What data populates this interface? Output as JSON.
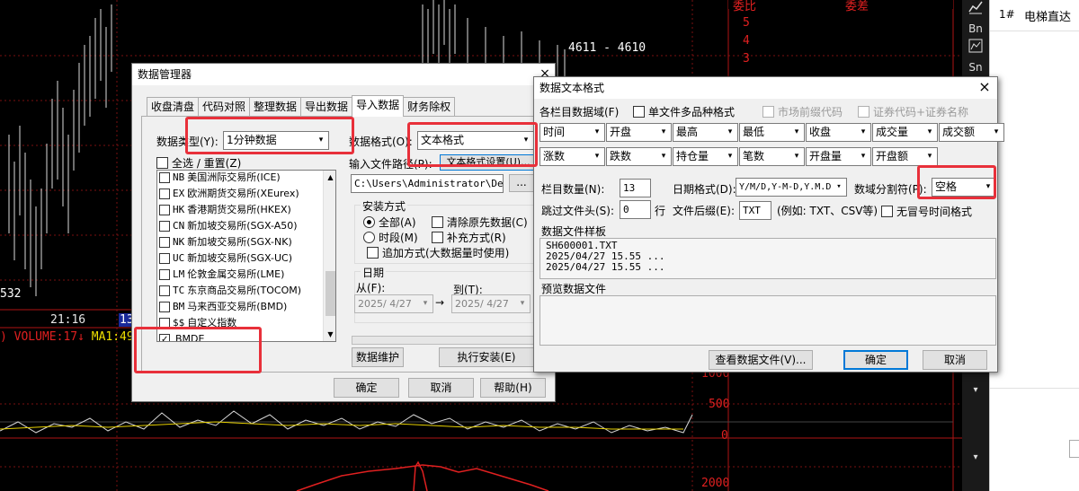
{
  "chart": {
    "price_label": "4611 - 4610",
    "low_label": "532",
    "time_tick_1": "21:16",
    "time_tick_2": "13",
    "volume_label": ") VOLUME:17",
    "ma_label": "MA1:49",
    "right_axis": [
      "5",
      "4",
      "3"
    ],
    "vol_axis_1": "500",
    "vol_axis_0": "0",
    "vol_axis_top": "1000",
    "bottom_axis": "2000",
    "header_left": "委比",
    "header_right": "委差"
  },
  "toolbar": {
    "items": [
      "Bn",
      "Sn"
    ],
    "icons": [
      "line-chart-icon",
      "chart-icon"
    ]
  },
  "right_panel": {
    "index": "1#",
    "name": "电梯直达"
  },
  "data_manager": {
    "title": "数据管理器",
    "tabs": [
      "收盘清盘",
      "代码对照",
      "整理数据",
      "导出数据",
      "导入数据",
      "财务除权"
    ],
    "active_tab": 4,
    "data_type_label": "数据类型(Y):",
    "data_type_value": "1分钟数据",
    "select_all_label": "全选 / 重置(Z)",
    "exchanges": [
      {
        "code": "NB",
        "name": "美国洲际交易所(ICE)",
        "checked": false
      },
      {
        "code": "EX",
        "name": "欧洲期货交易所(XEurex)",
        "checked": false
      },
      {
        "code": "HK",
        "name": "香港期货交易所(HKEX)",
        "checked": false
      },
      {
        "code": "CN",
        "name": "新加坡交易所(SGX-A50)",
        "checked": false
      },
      {
        "code": "NK",
        "name": "新加坡交易所(SGX-NK)",
        "checked": false
      },
      {
        "code": "UC",
        "name": "新加坡交易所(SGX-UC)",
        "checked": false
      },
      {
        "code": "LM",
        "name": "伦敦金属交易所(LME)",
        "checked": false
      },
      {
        "code": "TC",
        "name": "东京商品交易所(TOCOM)",
        "checked": false
      },
      {
        "code": "BM",
        "name": "马来西亚交易所(BMD)",
        "checked": false
      },
      {
        "code": "$$",
        "name": "自定义指数",
        "checked": false
      },
      {
        "code": "",
        "name": "BMDE",
        "checked": true
      }
    ],
    "data_format_label": "数据格式(O):",
    "data_format_value": "文本格式",
    "input_path_label": "输入文件路径(P):",
    "format_settings_button": "文本格式设置(U)...",
    "path_value": "C:\\Users\\Administrator\\Deskt",
    "browse_button": "...",
    "install_group": "安装方式",
    "opt_all": "全部(A)",
    "opt_period": "时段(M)",
    "chk_clear": "清除原先数据(C)",
    "chk_supplement": "补充方式(R)",
    "chk_append": "追加方式(大数据量时使用)",
    "date_group": "日期",
    "from_label": "从(F):",
    "to_label": "到(T):",
    "from_value": "2025/ 4/27",
    "to_value": "2025/ 4/27",
    "maintain_button": "数据维护",
    "execute_button": "执行安装(E)",
    "ok": "确定",
    "cancel": "取消",
    "help": "帮助(H)"
  },
  "text_format": {
    "title": "数据文本格式",
    "fields_label": "各栏目数据域(F)",
    "single_file_label": "单文件多品种格式",
    "market_prefix_label": "市场前缀代码",
    "security_code_label": "证券代码+证券名称",
    "fields_row1": [
      "时间",
      "开盘",
      "最高",
      "最低",
      "收盘",
      "成交量",
      "成交额"
    ],
    "fields_row2": [
      "涨数",
      "跌数",
      "持仓量",
      "笔数",
      "开盘量",
      "开盘额"
    ],
    "column_count_label": "栏目数量(N):",
    "column_count": "13",
    "date_format_label": "日期格式(D):",
    "date_format_value": "Y/M/D,Y-M-D,Y.M.D",
    "separator_label": "数域分割符(P):",
    "separator_value": "空格",
    "skip_header_label": "跳过文件头(S):",
    "skip_header_value": "0",
    "rows_unit": "行",
    "suffix_label": "文件后缀(E):",
    "suffix_value": "TXT",
    "suffix_example": "(例如: TXT、CSV等)",
    "no_colon_label": "无冒号时间格式",
    "sample_label": "数据文件样板",
    "sample_lines": [
      "SH600001.TXT",
      "2025/04/27 15.55 ...",
      "2025/04/27 15.55 ..."
    ],
    "preview_label": "预览数据文件",
    "view_file_button": "查看数据文件(V)...",
    "ok": "确定",
    "cancel": "取消"
  }
}
